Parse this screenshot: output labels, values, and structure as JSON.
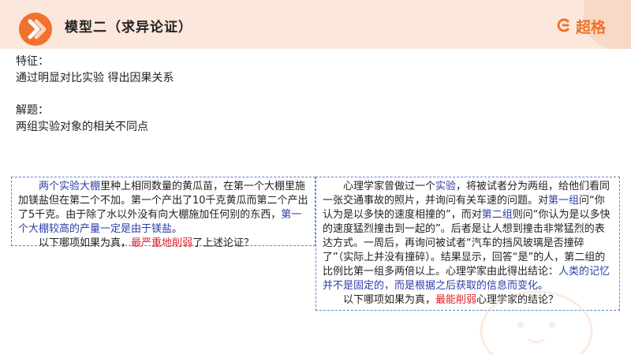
{
  "header": {
    "title": "模型二（求异论证）",
    "brand": "超格"
  },
  "features": {
    "label": "特征：",
    "text": "通过明显对比实验 得出因果关系"
  },
  "solution": {
    "label": "解题：",
    "text": "两组实验对象的相关不同点"
  },
  "box1": {
    "p1_a": "两个实验大棚",
    "p1_b": "里种上相同数量的黄瓜苗，在第一个大棚里施加镁盐但在第二个不加。第一个产出了10千克黄瓜而第二个产出了5千克。由于除了水以外没有向大棚施加任何别的东西，",
    "p1_c": "第一个大棚较高的产量一定是由于镁盐",
    "p1_d": "。",
    "p2_a": "以下哪项如果为真，",
    "p2_b": "最严重地削弱",
    "p2_c": "了上述论证？"
  },
  "box2": {
    "s1": "心理学家曾做过一个",
    "s2": "实验",
    "s3": "，将被试者分为两组，给他们看同一张交通事故的照片，并询问有关车速的问题。对",
    "s4": "第一组",
    "s5": "问“你认为是以多快的速度相撞的”，而对",
    "s6": "第二组",
    "s7": "则问“你认为是以多快的速度猛烈撞击到一起的”。后者是让人想到撞击非常猛烈的表达方式。一周后，再询问被试者“汽车的挡风玻璃是否撞碎了”（实际上并没有撞碎）。结果显示，回答“是”的人，第二组的比例比第一组多两倍以上。心理学家由此得出结论：",
    "s8": "人类的记忆并不是固定的，而是根据之后获取的信息而变化",
    "s9": "。",
    "q1": "以下哪项如果为真，",
    "q2": "最能削弱",
    "q3": "心理学家的结论？"
  },
  "colors": {
    "accent": "#f0722d",
    "header_bg": "#fbe7dc",
    "highlight_blue": "#2c3ea8",
    "highlight_red": "#e0232a",
    "box_border": "#5a86c9"
  }
}
